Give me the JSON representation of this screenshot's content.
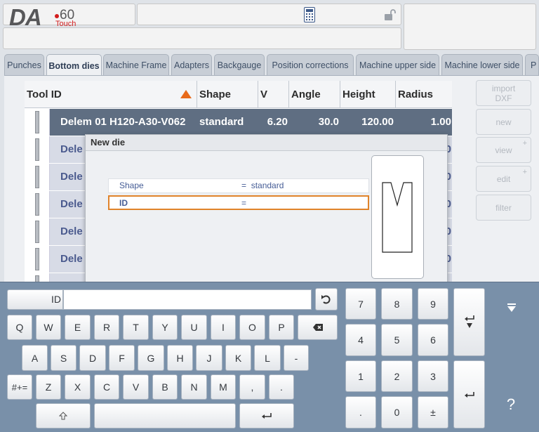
{
  "header": {
    "logo_da": "DA",
    "logo_model": "60",
    "logo_touch": "Touch",
    "calculator_icon": "calculator-icon",
    "lock_icon": "padlock-open-icon"
  },
  "tabs": [
    "Punches",
    "Bottom dies",
    "Machine Frame",
    "Adapters",
    "Backgauge",
    "Position corrections",
    "Machine upper side",
    "Machine lower side",
    "P"
  ],
  "table": {
    "columns": {
      "tool_id": "Tool ID",
      "shape": "Shape",
      "v": "V",
      "angle": "Angle",
      "height": "Height",
      "radius": "Radius"
    },
    "selected_row": {
      "tool_id": "Delem 01 H120-A30-V062",
      "shape": "standard",
      "v": "6.20",
      "angle": "30.0",
      "height": "120.00",
      "radius": "1.00"
    },
    "other_rows": [
      {
        "tool_id": "Dele",
        "radius": "0"
      },
      {
        "tool_id": "Dele",
        "radius": "0"
      },
      {
        "tool_id": "Dele",
        "radius": "0"
      },
      {
        "tool_id": "Dele",
        "radius": "0"
      },
      {
        "tool_id": "Dele",
        "radius": "0"
      }
    ]
  },
  "side_buttons": {
    "import_dxf": "import\nDXF",
    "new": "new",
    "view": "view",
    "edit": "edit",
    "filter": "filter",
    "plus": "+"
  },
  "dialog": {
    "title": "New die",
    "fields": [
      {
        "label": "Shape",
        "eq": "=",
        "value": "standard"
      },
      {
        "label": "ID",
        "eq": "=",
        "value": ""
      }
    ]
  },
  "keyboard": {
    "input_label": "ID",
    "input_value": "",
    "row1": [
      "Q",
      "W",
      "E",
      "R",
      "T",
      "Y",
      "U",
      "I",
      "O",
      "P"
    ],
    "row2": [
      "A",
      "S",
      "D",
      "F",
      "G",
      "H",
      "J",
      "K",
      "L",
      "-"
    ],
    "row3": [
      "Z",
      "X",
      "C",
      "V",
      "B",
      "N",
      "M",
      ",",
      "."
    ],
    "sym_key": "#+=",
    "numpad": [
      "7",
      "8",
      "9",
      "4",
      "5",
      "6",
      "1",
      "2",
      "3",
      ".",
      "0",
      "±"
    ],
    "help": "?"
  }
}
